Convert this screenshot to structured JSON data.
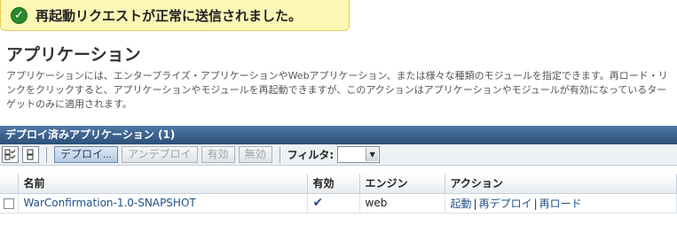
{
  "toast": {
    "message": "再起動リクエストが正常に送信されました。",
    "icon": "check-circle-icon"
  },
  "page": {
    "title": "アプリケーション",
    "description": "アプリケーションには、エンタープライズ・アプリケーションやWebアプリケーション、または様々な種類のモジュールを指定できます。再ロード・リンクをクリックすると、アプリケーションやモジュールを再起動できますが、このアクションはアプリケーションやモジュールが有効になっているターゲットのみに適用されます。"
  },
  "panel": {
    "title": "デプロイ済みアプリケーション (1)"
  },
  "toolbar": {
    "select_all_icon": "select-all-icon",
    "deselect_all_icon": "deselect-all-icon",
    "deploy": "デプロイ...",
    "undeploy": "アンデプロイ",
    "enable": "有効",
    "disable": "無効",
    "filter_label": "フィルタ:",
    "filter_value": ""
  },
  "table": {
    "columns": [
      "名前",
      "有効",
      "エンジン",
      "アクション"
    ],
    "rows": [
      {
        "name": "WarConfirmation-1.0-SNAPSHOT",
        "enabled": "✔",
        "engine": "web",
        "actions": [
          "起動",
          "再デプロイ",
          "再ロード"
        ]
      }
    ]
  },
  "colors": {
    "toast_bg": "#fdf7b6",
    "header_bg": "#2c4f78",
    "link": "#1f4f8a",
    "success": "#2a8a2a"
  }
}
